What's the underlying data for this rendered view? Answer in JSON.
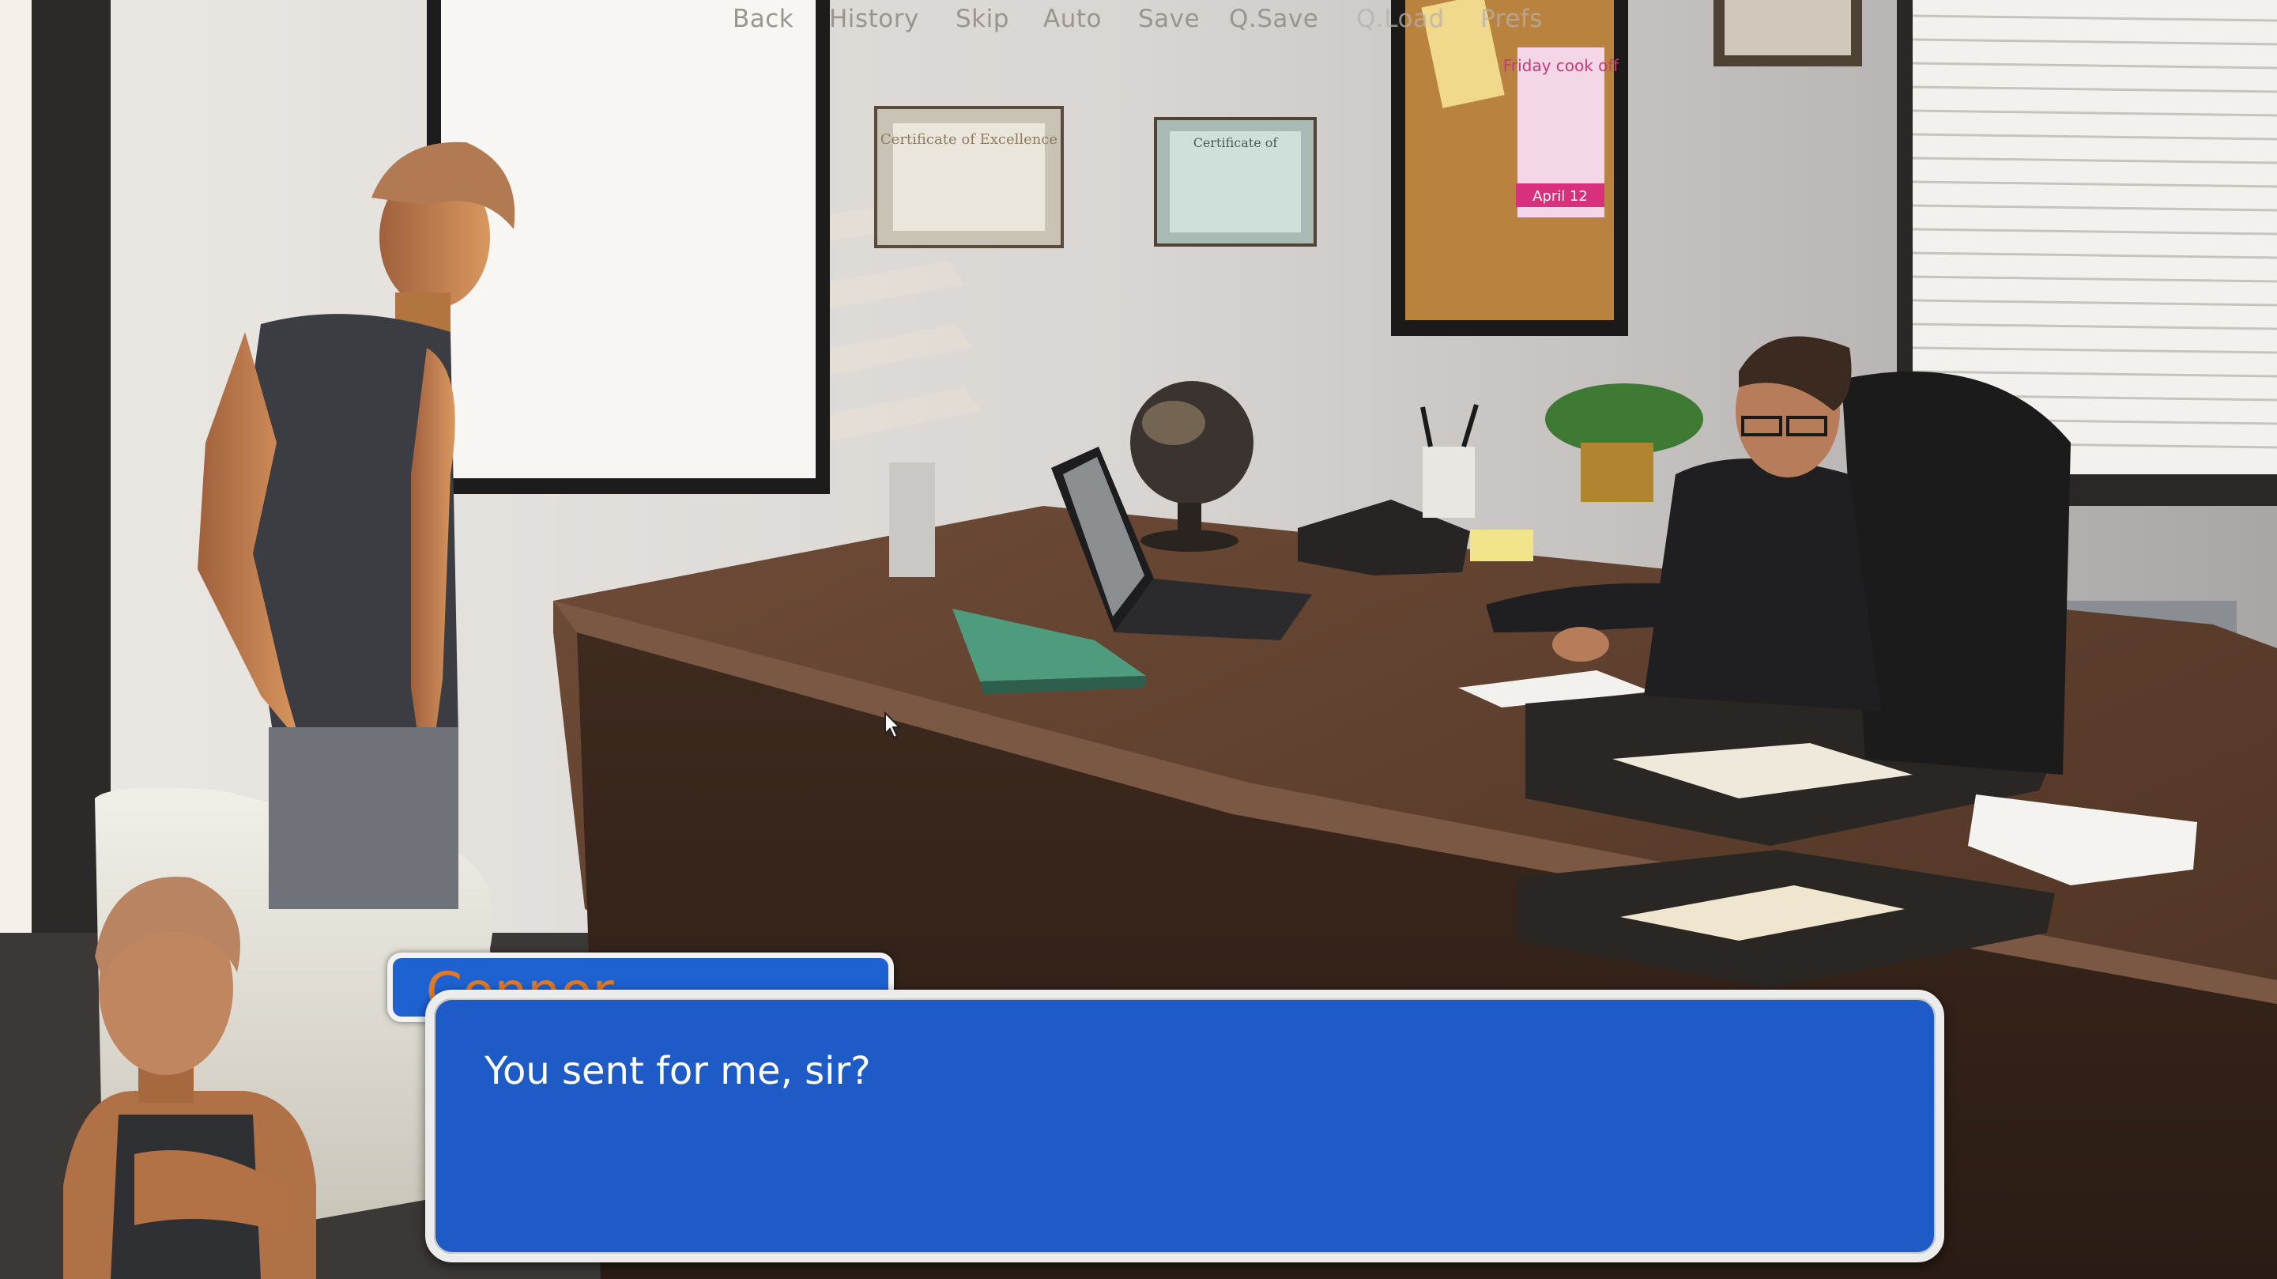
{
  "quick_menu": {
    "items": [
      {
        "label": "Back"
      },
      {
        "label": "History"
      },
      {
        "label": "Skip"
      },
      {
        "label": "Auto"
      },
      {
        "label": "Save"
      },
      {
        "label": "Q.Save"
      },
      {
        "label": "Q.Load"
      },
      {
        "label": "Prefs"
      }
    ]
  },
  "scene": {
    "certificate_left": "Certificate of Excellence",
    "certificate_right": "Certificate of",
    "poster_title": "Friday cook off",
    "poster_date": "April 12"
  },
  "dialogue": {
    "speaker": "Connor",
    "line": "You sent for me, sir?"
  },
  "colors": {
    "textbox_blue": "#1f5bc7",
    "namebox_blue": "#1e62d2",
    "speaker_orange": "#e07a24",
    "menu_gray": "#9b958f"
  }
}
